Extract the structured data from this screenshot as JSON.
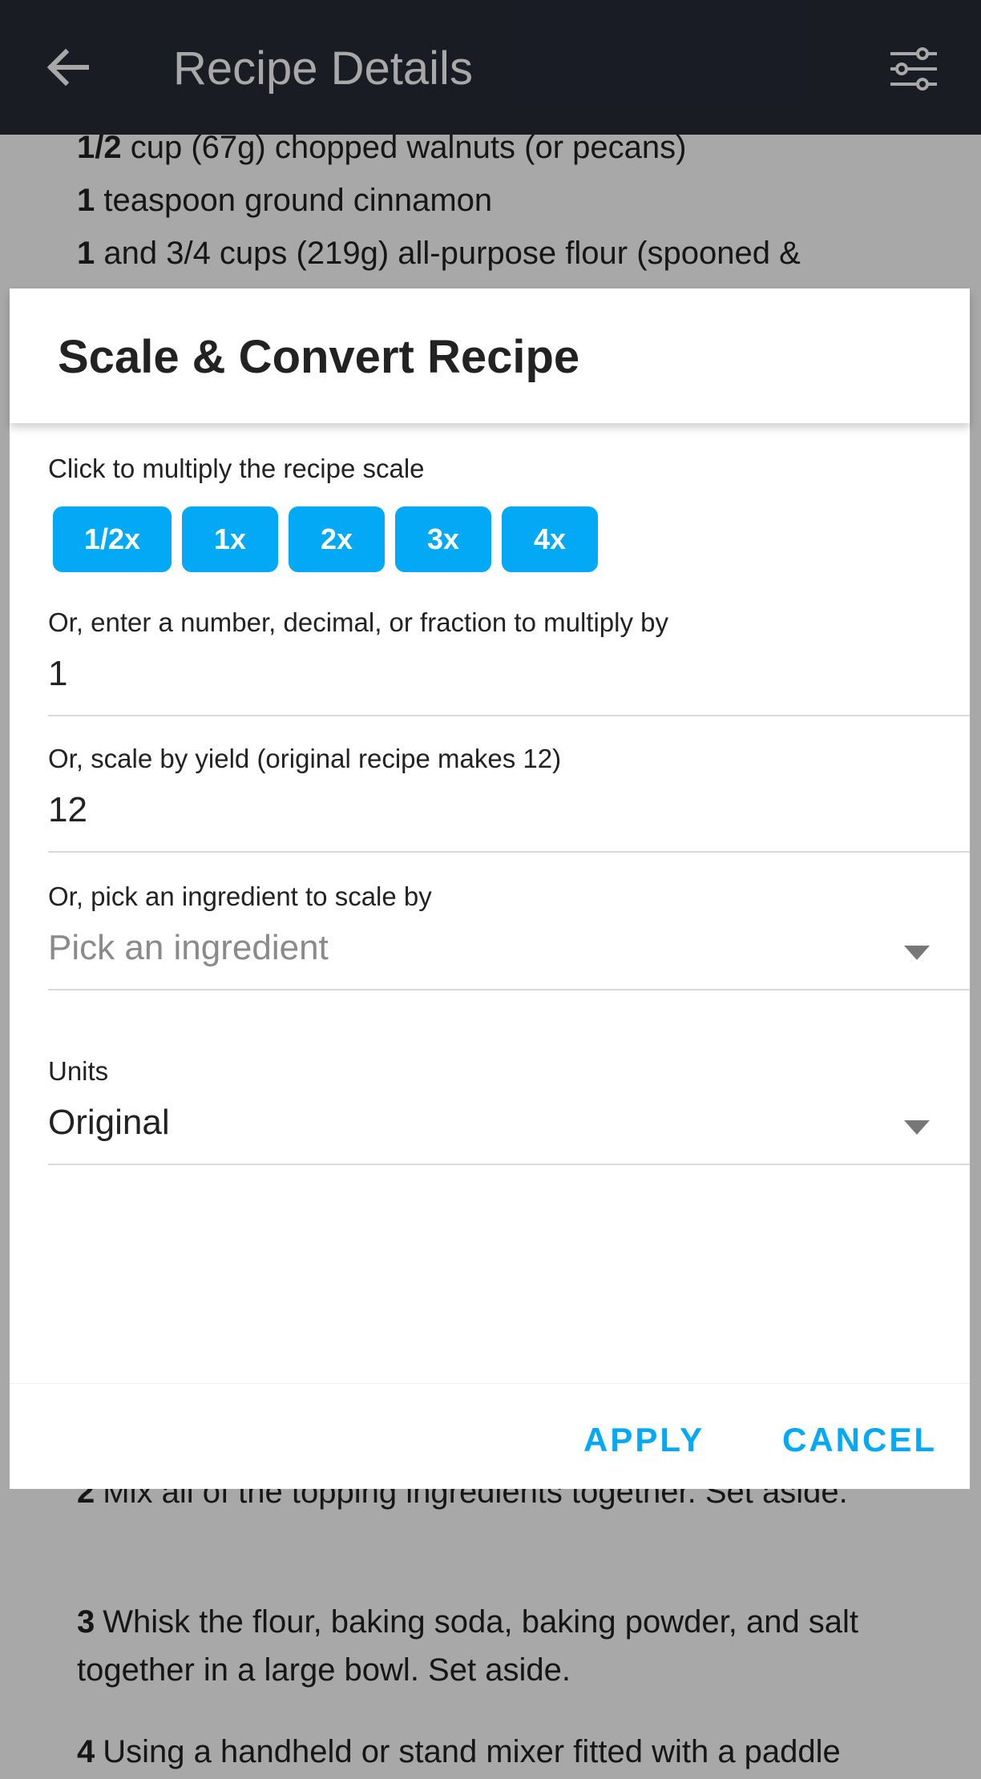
{
  "appbar": {
    "title": "Recipe Details",
    "back_icon": "arrow-left-icon",
    "settings_icon": "tune-sliders-icon"
  },
  "background": {
    "ingredients": [
      {
        "qty": "1/2",
        "text": " cup (67g) chopped walnuts (or pecans)"
      },
      {
        "qty": "1",
        "text": " teaspoon ground cinnamon"
      },
      {
        "qty": "1",
        "text": " and 3/4 cups (219g) all-purpose flour (spooned &"
      }
    ],
    "steps": [
      {
        "num": "2",
        "text": "Mix all of the topping ingredients together. Set aside."
      },
      {
        "num": "3",
        "text": "Whisk the flour, baking soda, baking powder, and salt together in a large bowl. Set aside."
      },
      {
        "num": "4",
        "text": "Using a handheld or stand mixer fitted with a paddle"
      }
    ]
  },
  "dialog": {
    "title": "Scale & Convert Recipe",
    "multiply_label": "Click to multiply the recipe scale",
    "scale_options": [
      "1/2x",
      "1x",
      "2x",
      "3x",
      "4x"
    ],
    "multiplier_label": "Or, enter a number, decimal, or fraction to multiply by",
    "multiplier_value": "1",
    "yield_label": "Or, scale by yield (original recipe makes 12)",
    "yield_value": "12",
    "ingredient_label": "Or, pick an ingredient to scale by",
    "ingredient_placeholder": "Pick an ingredient",
    "units_label": "Units",
    "units_value": "Original",
    "apply_label": "APPLY",
    "cancel_label": "CANCEL"
  },
  "colors": {
    "appbar": "#262b36",
    "accent": "#03a9f4"
  }
}
